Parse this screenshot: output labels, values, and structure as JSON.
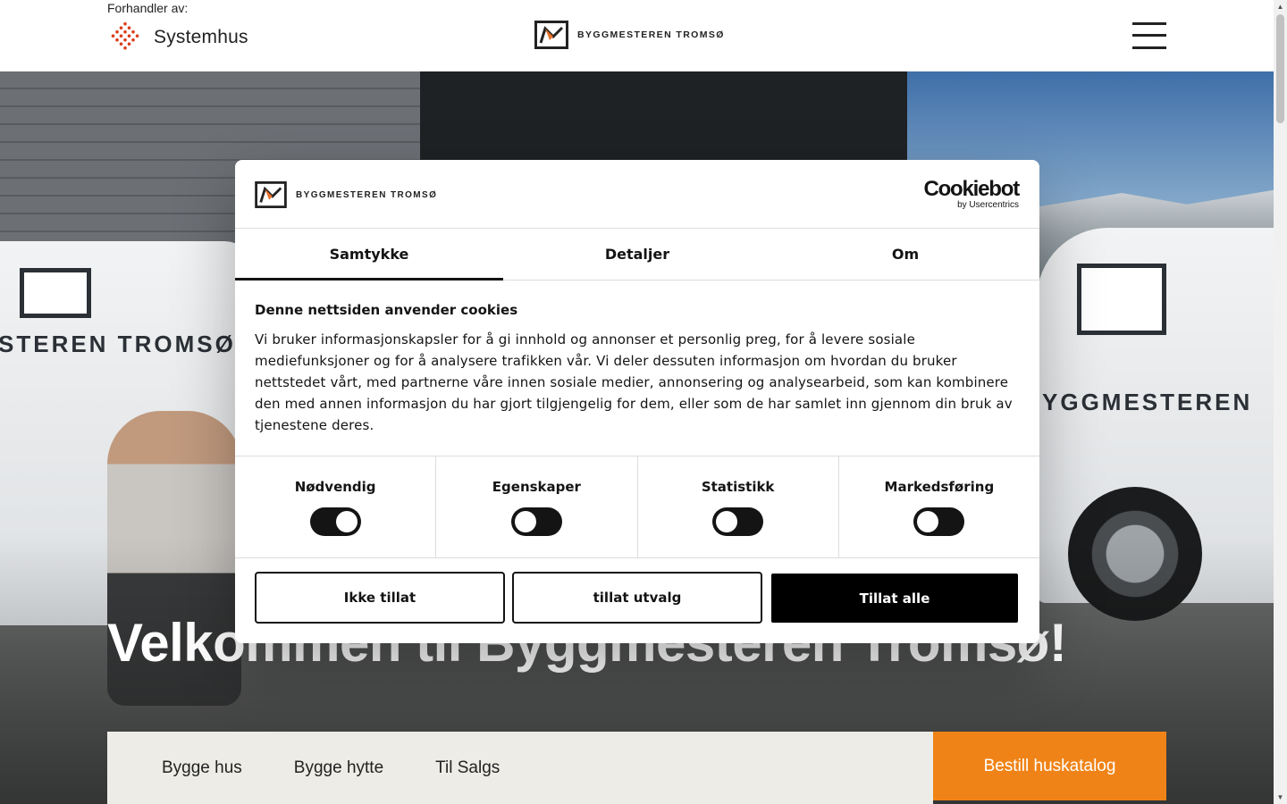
{
  "header": {
    "dealer_label": "Forhandler av:",
    "dealer_brand": "Systemhus",
    "brand_name": "BYGGMESTEREN TROMSØ",
    "menu_icon": "hamburger-menu-icon"
  },
  "hero": {
    "title": "Velkommen til Byggmesteren Tromsø!",
    "van_text_left": "STEREN TROMSØ",
    "van_text_right": "YGGMESTEREN"
  },
  "subnav": {
    "links": [
      "Bygge hus",
      "Bygge hytte",
      "Til Salgs"
    ],
    "catalog_button": "Bestill huskatalog"
  },
  "cookie_dialog": {
    "brand_name": "BYGGMESTEREN TROMSØ",
    "provider_name": "Cookiebot",
    "provider_sub": "by Usercentrics",
    "tabs": [
      "Samtykke",
      "Detaljer",
      "Om"
    ],
    "active_tab": "Samtykke",
    "title": "Denne nettsiden anvender cookies",
    "text": "Vi bruker informasjonskapsler for å gi innhold og annonser et personlig preg, for å levere sosiale mediefunksjoner og for å analysere trafikken vår. Vi deler dessuten informasjon om hvordan du bruker nettstedet vårt, med partnerne våre innen sosiale medier, annonsering og analysearbeid, som kan kombinere den med annen informasjon du har gjort tilgjengelig for dem, eller som de har samlet inn gjennom din bruk av tjenestene deres.",
    "categories": [
      {
        "label": "Nødvendig",
        "checked": true
      },
      {
        "label": "Egenskaper",
        "checked": false
      },
      {
        "label": "Statistikk",
        "checked": false
      },
      {
        "label": "Markedsføring",
        "checked": false
      }
    ],
    "buttons": {
      "deny": "Ikke tillat",
      "allow_selection": "tillat utvalg",
      "allow_all": "Tillat alle"
    }
  },
  "colors": {
    "accent_orange": "#f08317",
    "subnav_bg": "#edece6",
    "dark": "#141414"
  }
}
